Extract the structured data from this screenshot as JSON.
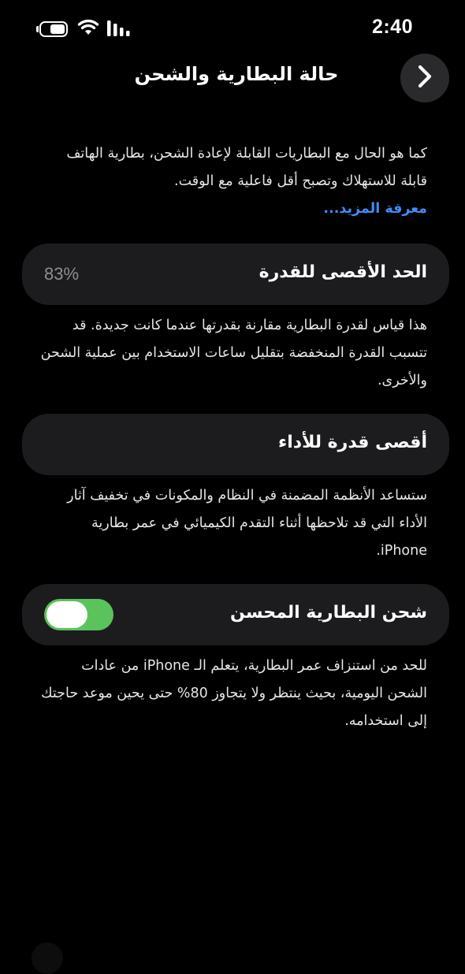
{
  "status_bar": {
    "time": "2:40",
    "battery_level": 0.6,
    "icons": [
      "battery-icon",
      "wifi-icon",
      "signal-icon"
    ]
  },
  "header": {
    "title": "حالة البطارية والشحن",
    "back_icon": "chevron-right-icon"
  },
  "intro": {
    "text": "كما هو الحال مع البطاريات القابلة لإعادة الشحن، بطارية الهاتف قابلة للاستهلاك وتصبح أقل فاعلية مع الوقت.",
    "learn_more": "معرفة المزيد..."
  },
  "max_capacity": {
    "label": "الحد الأقصى للقدرة",
    "value": "83%",
    "description": "هذا قياس لقدرة البطارية مقارنة بقدرتها عندما كانت جديدة. قد تتسبب القدرة المنخفضة بتقليل ساعات الاستخدام بين عملية الشحن والأخرى."
  },
  "peak_performance": {
    "label": "أقصى قدرة للأداء",
    "description": "ستساعد الأنظمة المضمنة في النظام والمكونات في تخفيف آثار الأداء التي قد تلاحظها أثناء التقدم الكيميائي في عمر بطارية iPhone."
  },
  "optimized_charging": {
    "label": "شحن البطارية المحسن",
    "enabled": true,
    "description": "للحد من استنزاف عمر البطارية، يتعلم الـ iPhone من عادات الشحن اليومية، بحيث ينتظر ولا يتجاوز 80% حتى يحين موعد حاجتك إلى استخدامه."
  },
  "colors": {
    "background": "#000000",
    "card": "#1c1c1e",
    "accent_link": "#3e8ef7",
    "toggle_on": "#5ac35c",
    "secondary_text": "#8e8e93"
  }
}
